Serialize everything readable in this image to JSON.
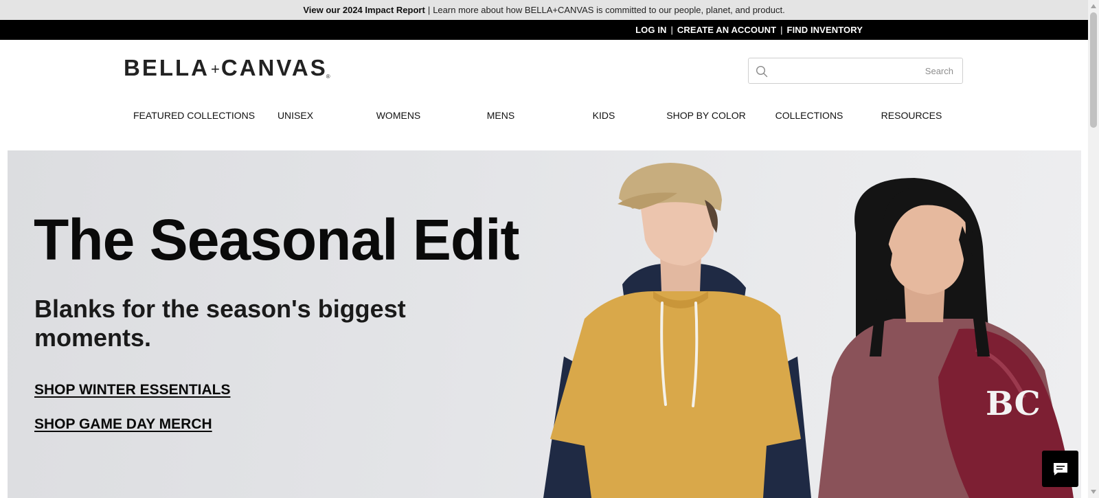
{
  "announcement": {
    "bold_text": "View our 2024 Impact Report",
    "separator": "|",
    "text": "Learn more about how BELLA+CANVAS is committed to our people, planet, and product."
  },
  "account_bar": {
    "login": "LOG IN",
    "create_account": "CREATE AN ACCOUNT",
    "find_inventory": "FIND INVENTORY",
    "separator": "|"
  },
  "logo": {
    "left": "BELLA",
    "plus": "+",
    "right": "CANVAS",
    "mark": "®"
  },
  "search": {
    "placeholder": "Search",
    "value": ""
  },
  "nav": {
    "items": [
      {
        "label": "FEATURED COLLECTIONS"
      },
      {
        "label": "UNISEX"
      },
      {
        "label": "WOMENS"
      },
      {
        "label": "MENS"
      },
      {
        "label": "KIDS"
      },
      {
        "label": "SHOP BY COLOR"
      },
      {
        "label": "COLLECTIONS"
      },
      {
        "label": "RESOURCES"
      }
    ]
  },
  "hero": {
    "title": "The Seasonal Edit",
    "subtitle": "Blanks for the season's biggest moments.",
    "links": [
      {
        "label": "SHOP WINTER ESSENTIALS"
      },
      {
        "label": "SHOP GAME DAY MERCH"
      }
    ],
    "jacket_letters": "BC"
  },
  "icons": {
    "search": "search-icon",
    "chat": "chat-bubble-icon"
  },
  "colors": {
    "announcement_bg": "#e4e4e4",
    "account_bar_bg": "#000000",
    "hero_bg": "#e3e4e7",
    "mustard_tee": "#d9a84a",
    "navy_hoodie": "#1f2a44",
    "maroon_jacket": "#7d1f33"
  }
}
